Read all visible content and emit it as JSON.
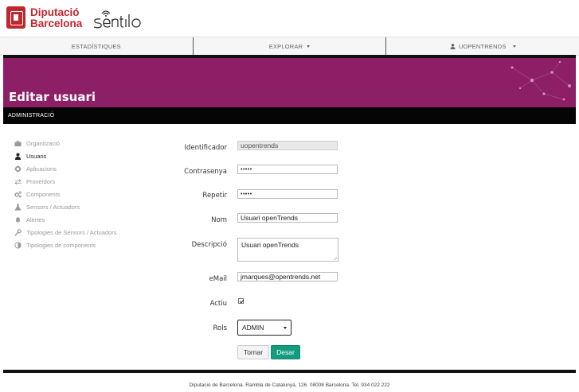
{
  "header": {
    "brand_line1": "Diputació",
    "brand_line2": "Barcelona",
    "product": "sentilo"
  },
  "nav": {
    "items": [
      {
        "label": "ESTADÍSTIQUES",
        "dropdown": false
      },
      {
        "label": "EXPLORAR",
        "dropdown": true
      },
      {
        "label": "UOPENTRENDS",
        "dropdown": true
      }
    ]
  },
  "banner": {
    "title": "Editar usuari",
    "color": "#8c1f66"
  },
  "section": {
    "label": "ADMINISTRACIÓ"
  },
  "sidebar": {
    "items": [
      {
        "label": "Organització",
        "icon": "briefcase-icon",
        "active": false
      },
      {
        "label": "Usuaris",
        "icon": "user-icon",
        "active": true
      },
      {
        "label": "Aplicacions",
        "icon": "gear-icon",
        "active": false
      },
      {
        "label": "Proveïdors",
        "icon": "transfer-icon",
        "active": false
      },
      {
        "label": "Components",
        "icon": "cogs-icon",
        "active": false
      },
      {
        "label": "Sensors / Actuadors",
        "icon": "flask-icon",
        "active": false
      },
      {
        "label": "Alertes",
        "icon": "bell-icon",
        "active": false
      },
      {
        "label": "Tipologies de Sensors / Actuadors",
        "icon": "wrench-icon",
        "active": false
      },
      {
        "label": "Tipologies de components",
        "icon": "adjust-icon",
        "active": false
      }
    ]
  },
  "form": {
    "identifier_label": "Identificador",
    "identifier_value": "uopentrends",
    "password_label": "Contrasenya",
    "password_value": "•••••",
    "repeat_label": "Repetir",
    "repeat_value": "•••••",
    "name_label": "Nom",
    "name_value": "Usuari openTrends",
    "description_label": "Descripció",
    "description_value": "Usuari openTrends",
    "email_label": "eMail",
    "email_value": "jmarques@opentrends.net",
    "active_label": "Actiu",
    "active_checked": true,
    "roles_label": "Rols",
    "roles_value": "ADMIN",
    "back_label": "Tornar",
    "save_label": "Desar",
    "save_color": "#149c80"
  },
  "footer": {
    "text": "Diputació de Barcelona. Rambla de Catalunya, 126. 08008 Barcelona. Tel. 934 022 222"
  }
}
